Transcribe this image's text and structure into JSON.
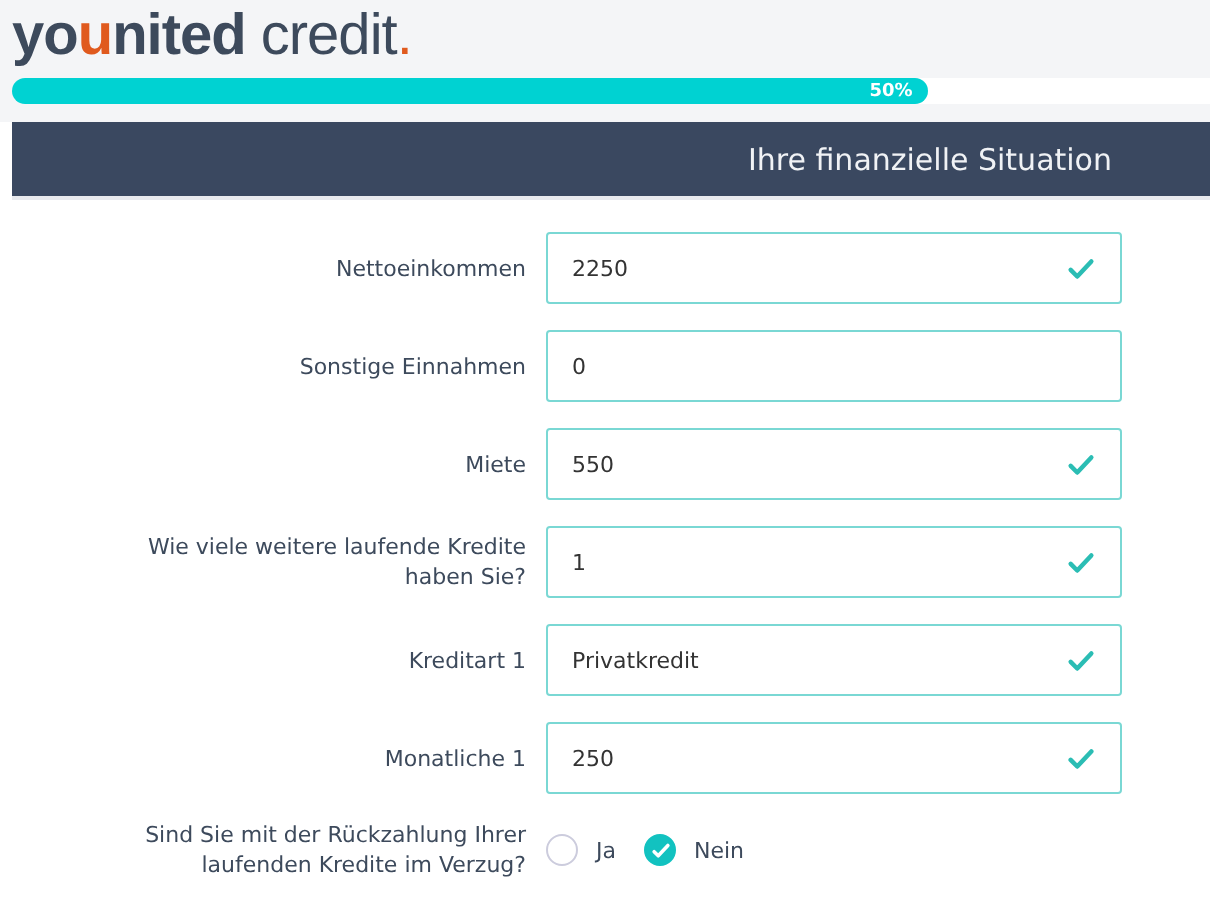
{
  "logo": [
    {
      "text": "yo",
      "kind": "bold",
      "color": "#3d4a5c"
    },
    {
      "text": "u",
      "kind": "bold",
      "color": "#e05a1e"
    },
    {
      "text": "nited",
      "kind": "bold",
      "color": "#3d4a5c"
    },
    {
      "text": " credit",
      "kind": "light",
      "color": "#3d4a5c"
    },
    {
      "text": ".",
      "kind": "light",
      "color": "#e05a1e"
    }
  ],
  "progress": {
    "level": 0.765,
    "reading": "50%"
  },
  "section_title": "Ihre finanzielle Situation",
  "fields": [
    {
      "label": "Nettoeinkommen",
      "value": "2250",
      "valid": true
    },
    {
      "label": "Sonstige Einnahmen",
      "value": "0",
      "valid": false
    },
    {
      "label": "Miete",
      "value": "550",
      "valid": true
    },
    {
      "label": "Wie viele weitere laufende Kredite haben Sie?",
      "value": "1",
      "valid": true
    },
    {
      "label": "Kreditart 1",
      "value": "Privatkredit",
      "valid": true
    },
    {
      "label": "Monatliche 1",
      "value": "250",
      "valid": true
    }
  ],
  "question": {
    "label": "Sind Sie mit der Rückzahlung Ihrer laufenden Kredite im Verzug?",
    "options": [
      {
        "label": "Ja",
        "selected": false
      },
      {
        "label": "Nein",
        "selected": true
      }
    ]
  }
}
